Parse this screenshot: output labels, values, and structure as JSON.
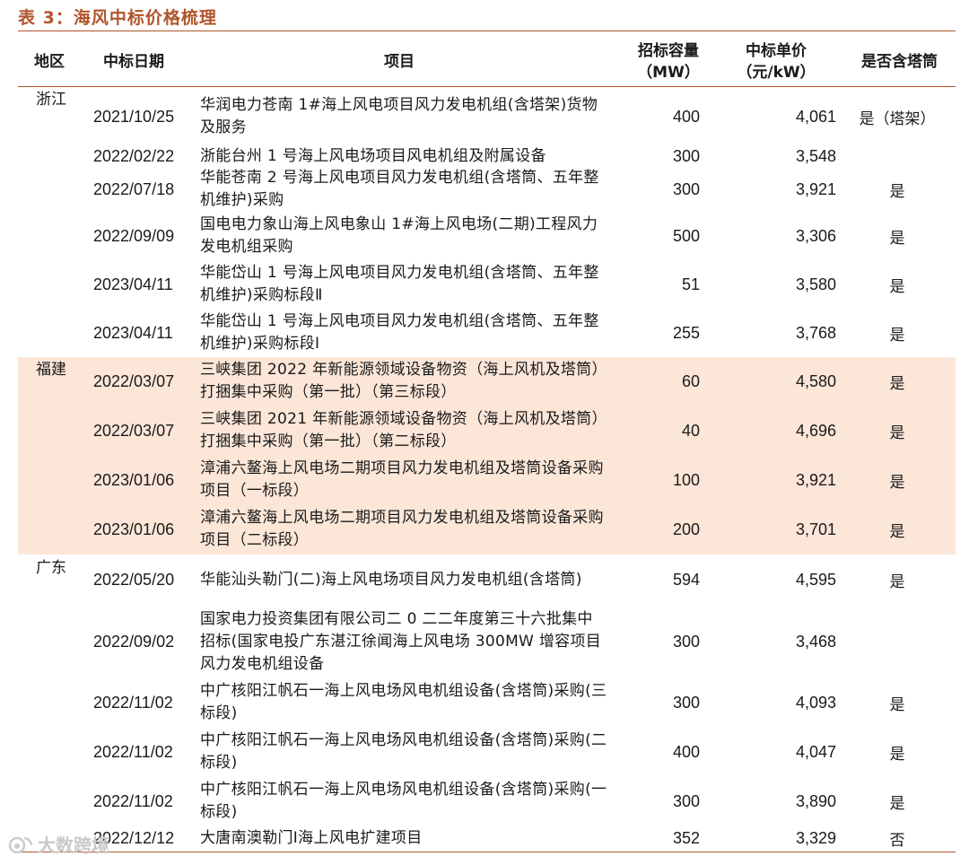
{
  "caption": "表 3：海风中标价格梳理",
  "headers": {
    "region": "地区",
    "date": "中标日期",
    "project": "项目",
    "capacity_line1": "招标容量",
    "capacity_line2": "（MW）",
    "price_line1": "中标单价",
    "price_line2": "（元/kW）",
    "tower": "是否含塔筒"
  },
  "regions": [
    "浙江",
    "福建",
    "广东"
  ],
  "rows": [
    {
      "date": "2021/10/25",
      "project": "华润电力苍南 1#海上风电项目风力发电机组(含塔架)货物及服务",
      "capacity": "400",
      "price": "4,061",
      "tower": "是（塔架）"
    },
    {
      "date": "2022/02/22",
      "project": "浙能台州 1 号海上风电场项目风电机组及附属设备",
      "capacity": "300",
      "price": "3,548",
      "tower": ""
    },
    {
      "date": "2022/07/18",
      "project": "华能苍南 2 号海上风电项目风力发电机组(含塔筒、五年整机维护)采购",
      "capacity": "300",
      "price": "3,921",
      "tower": "是"
    },
    {
      "date": "2022/09/09",
      "project": "国电电力象山海上风电象山 1#海上风电场(二期)工程风力发电机组采购",
      "capacity": "500",
      "price": "3,306",
      "tower": "是"
    },
    {
      "date": "2023/04/11",
      "project": "华能岱山 1 号海上风电项目风力发电机组(含塔筒、五年整机维护)采购标段Ⅱ",
      "capacity": "51",
      "price": "3,580",
      "tower": "是"
    },
    {
      "date": "2023/04/11",
      "project": "华能岱山 1 号海上风电项目风力发电机组(含塔筒、五年整机维护)采购标段Ⅰ",
      "capacity": "255",
      "price": "3,768",
      "tower": "是"
    },
    {
      "date": "2022/03/07",
      "project": "三峡集团 2022 年新能源领域设备物资（海上风机及塔筒）打捆集中采购（第一批）（第三标段）",
      "capacity": "60",
      "price": "4,580",
      "tower": "是"
    },
    {
      "date": "2022/03/07",
      "project": "三峡集团 2021 年新能源领域设备物资（海上风机及塔筒）打捆集中采购（第一批）（第二标段）",
      "capacity": "40",
      "price": "4,696",
      "tower": "是"
    },
    {
      "date": "2023/01/06",
      "project": "漳浦六鳌海上风电场二期项目风力发电机组及塔筒设备采购项目（一标段）",
      "capacity": "100",
      "price": "3,921",
      "tower": "是"
    },
    {
      "date": "2023/01/06",
      "project": "漳浦六鳌海上风电场二期项目风力发电机组及塔筒设备采购项目（二标段）",
      "capacity": "200",
      "price": "3,701",
      "tower": "是"
    },
    {
      "date": "2022/05/20",
      "project": "华能汕头勒门(二)海上风电场项目风力发电机组(含塔筒)",
      "capacity": "594",
      "price": "4,595",
      "tower": "是"
    },
    {
      "date": "2022/09/02",
      "project": "国家电力投资集团有限公司二 0 二二年度第三十六批集中招标(国家电投广东湛江徐闻海上风电场 300MW 增容项目风力发电机组设备",
      "capacity": "300",
      "price": "3,468",
      "tower": ""
    },
    {
      "date": "2022/11/02",
      "project": "中广核阳江帆石一海上风电场风电机组设备(含塔筒)采购(三标段)",
      "capacity": "300",
      "price": "4,093",
      "tower": "是"
    },
    {
      "date": "2022/11/02",
      "project": "中广核阳江帆石一海上风电场风电机组设备(含塔筒)采购(二标段)",
      "capacity": "400",
      "price": "4,047",
      "tower": "是"
    },
    {
      "date": "2022/11/02",
      "project": "中广核阳江帆石一海上风电场风电机组设备(含塔筒)采购(一标段)",
      "capacity": "300",
      "price": "3,890",
      "tower": "是"
    },
    {
      "date": "2022/12/12",
      "project": "大唐南澳勒门Ⅰ海上风电扩建项目",
      "capacity": "352",
      "price": "3,329",
      "tower": "否"
    }
  ],
  "watermark": "大数跨境"
}
